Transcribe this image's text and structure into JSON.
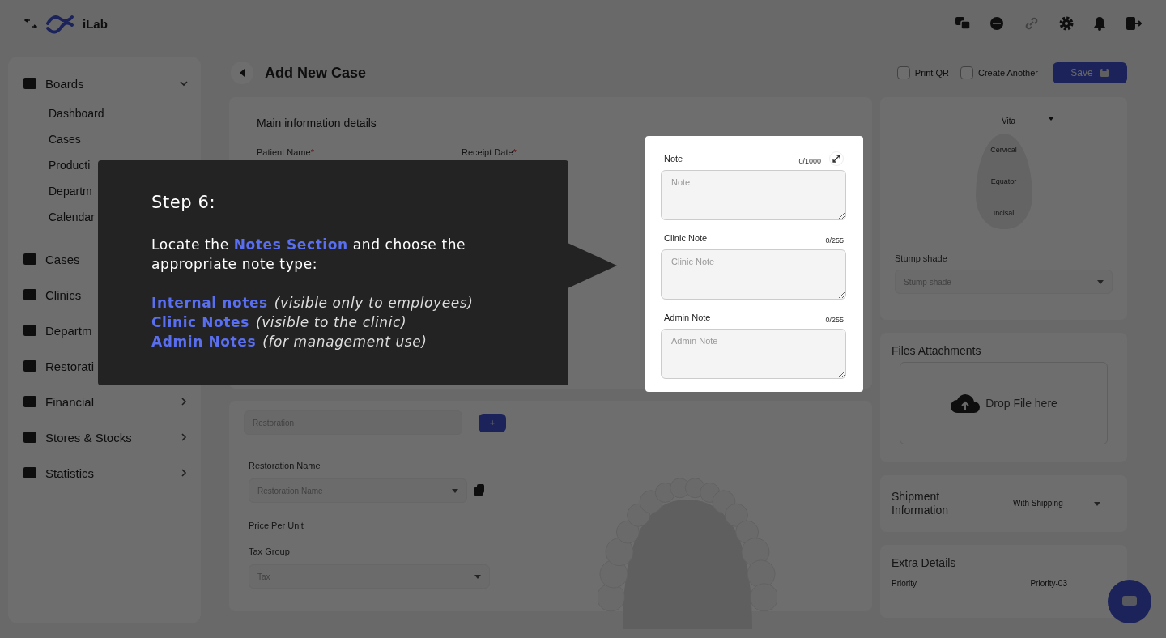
{
  "topbar": {
    "logo_text": "iLab"
  },
  "sidebar": {
    "items": [
      {
        "label": "Boards",
        "expanded": true,
        "children": [
          {
            "label": "Dashboard"
          },
          {
            "label": "Cases"
          },
          {
            "label": "Producti"
          },
          {
            "label": "Departm"
          },
          {
            "label": "Calendar"
          }
        ]
      },
      {
        "label": "Cases"
      },
      {
        "label": "Clinics"
      },
      {
        "label": "Departm"
      },
      {
        "label": "Restorati"
      },
      {
        "label": "Financial",
        "expanded": false
      },
      {
        "label": "Stores & Stocks",
        "expanded": false
      },
      {
        "label": "Statistics",
        "expanded": false
      }
    ]
  },
  "page": {
    "title": "Add New Case",
    "options": [
      {
        "label": "Print QR",
        "checked": false
      },
      {
        "label": "Create Another",
        "checked": false
      }
    ],
    "save_button": "Save"
  },
  "main_info": {
    "title": "Main information details",
    "fields": [
      {
        "label": "Patient Name",
        "required_mark": "*"
      },
      {
        "label": "Receipt Date",
        "required_mark": "*"
      }
    ]
  },
  "restoration": {
    "tabs": [
      {
        "label": "Restoration",
        "selected": true
      },
      {
        "label": "+",
        "selected": false
      }
    ],
    "name_label": "Restoration Name",
    "name_placeholder": "Restoration Name",
    "price_label": "Price Per Unit",
    "tax_label": "Tax Group",
    "tax_placeholder": "Tax"
  },
  "shade": {
    "system": "Vita",
    "zones": [
      "Cervical",
      "Equator",
      "Incisal"
    ],
    "stump_label": "Stump shade",
    "stump_placeholder": "Stump shade"
  },
  "files": {
    "title": "Files Attachments",
    "drop_text": "Drop File here"
  },
  "shipment": {
    "title": "Shipment Information",
    "value": "With Shipping"
  },
  "extra": {
    "title": "Extra Details",
    "priority_label": "Priority",
    "priority_value": "Priority-03"
  },
  "tour": {
    "title": "Step 6:",
    "intro": "Locate the **Notes Section** and choose the appropriate note type:",
    "items": [
      {
        "name": "Internal notes",
        "description": "(visible only to employees)"
      },
      {
        "name": "Clinic Notes",
        "description": "(visible to the clinic)"
      },
      {
        "name": "Admin Notes",
        "description": "(for management use)"
      }
    ]
  },
  "notes": [
    {
      "label": "Note",
      "count": "0/1000",
      "placeholder": "Note",
      "expandable": true
    },
    {
      "label": "Clinic Note",
      "count": "0/255",
      "placeholder": "Clinic Note",
      "expandable": false
    },
    {
      "label": "Admin Note",
      "count": "0/255",
      "placeholder": "Admin Note",
      "expandable": false
    }
  ]
}
